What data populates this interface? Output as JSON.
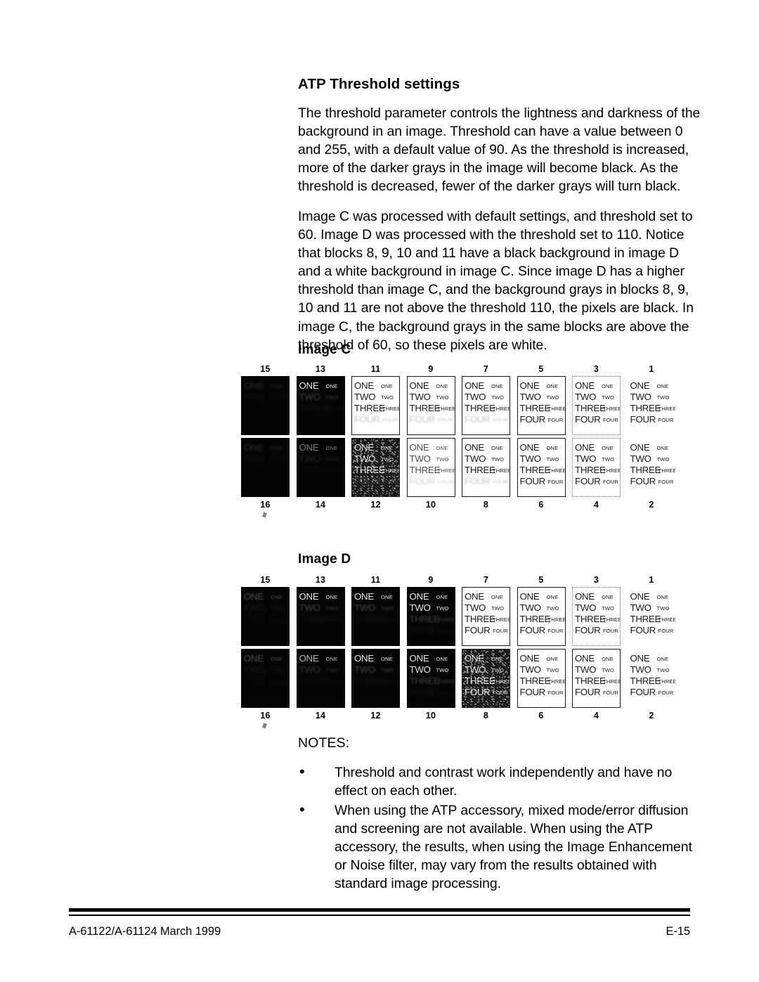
{
  "document": {
    "section_heading": "ATP Threshold settings",
    "paragraphs": [
      "The threshold parameter controls the lightness and darkness of the background in an image. Threshold can have a value between 0 and 255, with a default value of 90. As the threshold is increased, more of the darker grays in the image will become black. As the threshold is decreased, fewer of the darker grays will turn black.",
      "Image C was processed with default settings, and threshold set to 60. Image D was processed with the threshold set to 110. Notice that blocks 8, 9, 10 and 11 have a black background in image D and a white background in image C. Since image D has a higher threshold than image C, and the background grays in blocks 8, 9, 10 and 11 are not above the threshold 110, the pixels are black. In image C, the background grays in the same blocks are above the threshold of 60, so these pixels are white."
    ]
  },
  "figures": [
    {
      "label": "Image C",
      "top_numbers": [
        "15",
        "13",
        "11",
        "9",
        "7",
        "5",
        "3",
        "1"
      ],
      "bottom_numbers": [
        "16",
        "14",
        "12",
        "10",
        "8",
        "6",
        "4",
        "2"
      ],
      "block_lines": [
        "ONE",
        "TWO",
        "THREE",
        "FOUR"
      ],
      "top_row_blocks": [
        {
          "number": "15",
          "style": "black",
          "visible_lines": 1,
          "fade": "f-14"
        },
        {
          "number": "13",
          "style": "black",
          "visible_lines": 1,
          "fade": "f-90"
        },
        {
          "number": "11",
          "style": "bordered",
          "visible_lines": 3,
          "fade": "f-90"
        },
        {
          "number": "9",
          "style": "bordered",
          "visible_lines": 3,
          "fade": "f-90"
        },
        {
          "number": "7",
          "style": "bordered",
          "visible_lines": 3,
          "fade": "f-90"
        },
        {
          "number": "5",
          "style": "bordered",
          "visible_lines": 4,
          "fade": "f-90"
        },
        {
          "number": "3",
          "style": "dashed",
          "visible_lines": 4,
          "fade": "f-90"
        },
        {
          "number": "1",
          "style": "plain",
          "visible_lines": 4,
          "fade": "f-90"
        }
      ],
      "bottom_row_blocks": [
        {
          "number": "16",
          "style": "black",
          "visible_lines": 1,
          "fade": "f-14"
        },
        {
          "number": "14",
          "style": "black",
          "visible_lines": 1,
          "fade": "f-45"
        },
        {
          "number": "12",
          "style": "noisy",
          "visible_lines": 3,
          "fade": "f-90"
        },
        {
          "number": "10",
          "style": "bordered",
          "visible_lines": 3,
          "fade": "f-70"
        },
        {
          "number": "8",
          "style": "bordered",
          "visible_lines": 3,
          "fade": "f-90"
        },
        {
          "number": "6",
          "style": "bordered",
          "visible_lines": 4,
          "fade": "f-90"
        },
        {
          "number": "4",
          "style": "dashed",
          "visible_lines": 4,
          "fade": "f-90"
        },
        {
          "number": "2",
          "style": "plain",
          "visible_lines": 4,
          "fade": "f-90"
        }
      ]
    },
    {
      "label": "Image D",
      "top_numbers": [
        "15",
        "13",
        "11",
        "9",
        "7",
        "5",
        "3",
        "1"
      ],
      "bottom_numbers": [
        "16",
        "14",
        "12",
        "10",
        "8",
        "6",
        "4",
        "2"
      ],
      "block_lines": [
        "ONE",
        "TWO",
        "THREE",
        "FOUR"
      ],
      "top_row_blocks": [
        {
          "number": "15",
          "style": "black",
          "visible_lines": 1,
          "fade": "f-28"
        },
        {
          "number": "13",
          "style": "black",
          "visible_lines": 1,
          "fade": "f-90"
        },
        {
          "number": "11",
          "style": "black",
          "visible_lines": 1,
          "fade": "f-90"
        },
        {
          "number": "9",
          "style": "black",
          "visible_lines": 2,
          "fade": "f-90"
        },
        {
          "number": "7",
          "style": "bordered",
          "visible_lines": 4,
          "fade": "f-90"
        },
        {
          "number": "5",
          "style": "bordered",
          "visible_lines": 4,
          "fade": "f-90"
        },
        {
          "number": "3",
          "style": "dashed",
          "visible_lines": 4,
          "fade": "f-90"
        },
        {
          "number": "1",
          "style": "plain",
          "visible_lines": 4,
          "fade": "f-90"
        }
      ],
      "bottom_row_blocks": [
        {
          "number": "16",
          "style": "black",
          "visible_lines": 1,
          "fade": "f-28"
        },
        {
          "number": "14",
          "style": "black",
          "visible_lines": 1,
          "fade": "f-70"
        },
        {
          "number": "12",
          "style": "black",
          "visible_lines": 1,
          "fade": "f-90"
        },
        {
          "number": "10",
          "style": "black",
          "visible_lines": 2,
          "fade": "f-90"
        },
        {
          "number": "8",
          "style": "noisy",
          "visible_lines": 4,
          "fade": "f-90"
        },
        {
          "number": "6",
          "style": "bordered",
          "visible_lines": 4,
          "fade": "f-90"
        },
        {
          "number": "4",
          "style": "bordered",
          "visible_lines": 4,
          "fade": "f-90"
        },
        {
          "number": "2",
          "style": "plain",
          "visible_lines": 4,
          "fade": "f-90"
        }
      ]
    }
  ],
  "notes": {
    "title": "NOTES:",
    "bullet_glyph": "•",
    "items": [
      "Threshold and contrast work independently and have no effect on each other.",
      "When using the ATP accessory, mixed mode/error diffusion and screening are not available. When using the ATP accessory, the results, when using the Image Enhancement or Noise filter, may vary from the results obtained with standard image processing."
    ]
  },
  "footer": {
    "left": "A-61122/A-61124  March 1999",
    "right": "E-15"
  }
}
